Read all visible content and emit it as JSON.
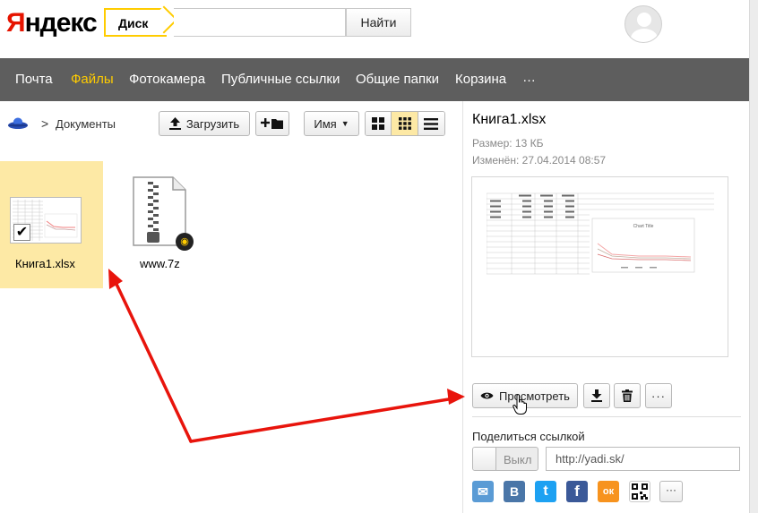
{
  "header": {
    "logo_y": "Я",
    "logo_rest": "ндекс",
    "search_tag": "Диск",
    "search_value": "",
    "search_button": "Найти"
  },
  "nav": {
    "items": [
      {
        "label": "Почта",
        "active": false
      },
      {
        "label": "Файлы",
        "active": true
      },
      {
        "label": "Фотокамера",
        "active": false
      },
      {
        "label": "Публичные ссылки",
        "active": false
      },
      {
        "label": "Общие папки",
        "active": false
      },
      {
        "label": "Корзина",
        "active": false
      },
      {
        "label": "…",
        "active": false
      }
    ]
  },
  "breadcrumb": {
    "separator": ">",
    "current": "Документы"
  },
  "toolbar": {
    "upload_label": "Загрузить",
    "sort_label": "Имя",
    "view_modes": [
      "large-icons",
      "small-icons",
      "list"
    ],
    "active_view": "small-icons"
  },
  "files": [
    {
      "name": "Книга1.xlsx",
      "selected": true,
      "type": "xlsx"
    },
    {
      "name": "www.7z",
      "selected": false,
      "type": "archive"
    }
  ],
  "details": {
    "title": "Книга1.xlsx",
    "size_text": "Размер: 13 КБ",
    "modified_text": "Изменён: 27.04.2014 08:57",
    "preview_chart_title": "Chart Title",
    "view_button": "Просмотреть",
    "more_label": "···",
    "share_title": "Поделиться ссылкой",
    "toggle_label": "Выкл",
    "share_url": "http://yadi.sk/"
  },
  "social": [
    {
      "name": "email",
      "glyph": "✉",
      "color": "#5a9bd5"
    },
    {
      "name": "vkontakte",
      "glyph": "В",
      "color": "#4a76a8"
    },
    {
      "name": "twitter",
      "glyph": "t",
      "color": "#1da1f2"
    },
    {
      "name": "facebook",
      "glyph": "f",
      "color": "#3b5998"
    },
    {
      "name": "odnoklassniki",
      "glyph": "ок",
      "color": "#f7931e"
    },
    {
      "name": "qr-code",
      "glyph": "",
      "color": "#ffffff"
    }
  ],
  "colors": {
    "accent_yellow": "#ffcc00",
    "selection": "#fde9a5",
    "nav_bg": "#5e5e5e",
    "annotation_arrow": "#e8140c"
  }
}
